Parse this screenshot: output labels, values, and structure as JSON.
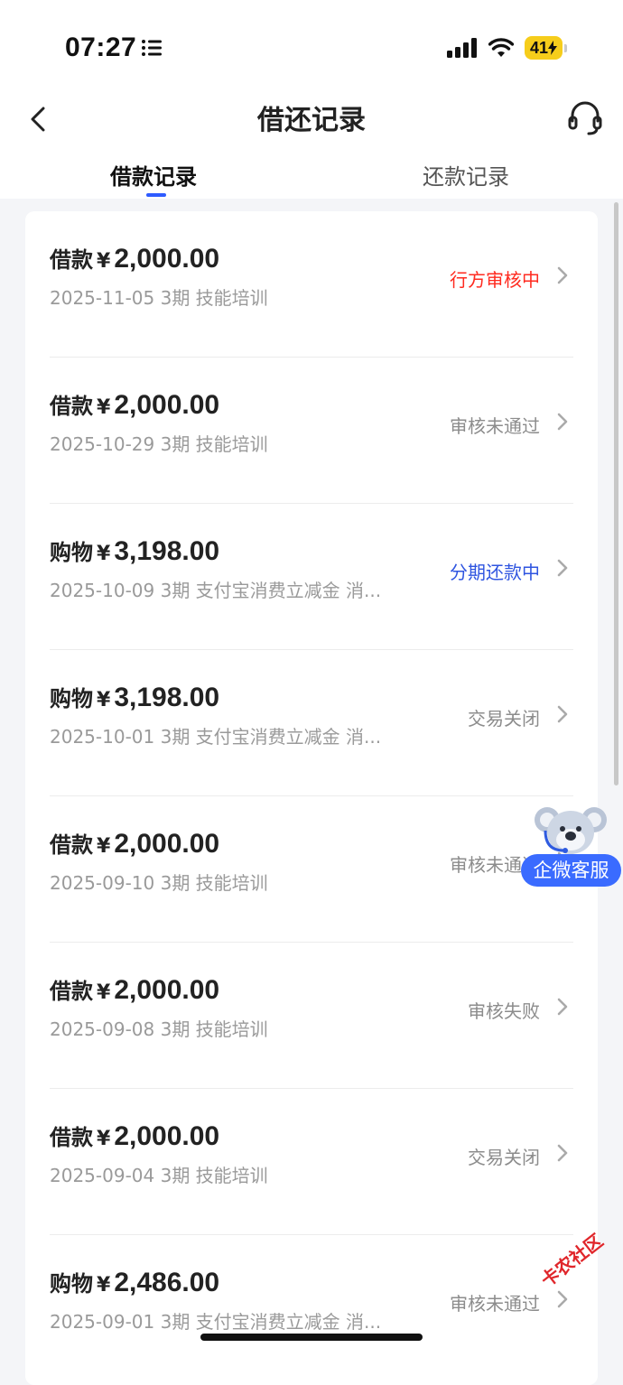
{
  "status_bar": {
    "time": "07:27",
    "battery": "41"
  },
  "header": {
    "title": "借还记录"
  },
  "tabs": [
    {
      "label": "借款记录",
      "active": true
    },
    {
      "label": "还款记录",
      "active": false
    }
  ],
  "records": [
    {
      "type": "借款",
      "currency": "¥",
      "amount": "2,000.00",
      "subtitle": "2025-11-05 3期  技能培训",
      "status": "行方审核中",
      "status_color": "#ff2a1f"
    },
    {
      "type": "借款",
      "currency": "¥",
      "amount": "2,000.00",
      "subtitle": "2025-10-29 3期  技能培训",
      "status": "审核未通过",
      "status_color": "#8c8c8c"
    },
    {
      "type": "购物",
      "currency": "¥",
      "amount": "3,198.00",
      "subtitle": "2025-10-09 3期  支付宝消费立减金 消...",
      "status": "分期还款中",
      "status_color": "#2f55e0"
    },
    {
      "type": "购物",
      "currency": "¥",
      "amount": "3,198.00",
      "subtitle": "2025-10-01 3期  支付宝消费立减金 消...",
      "status": "交易关闭",
      "status_color": "#8c8c8c"
    },
    {
      "type": "借款",
      "currency": "¥",
      "amount": "2,000.00",
      "subtitle": "2025-09-10 3期  技能培训",
      "status": "审核未通过",
      "status_color": "#8c8c8c"
    },
    {
      "type": "借款",
      "currency": "¥",
      "amount": "2,000.00",
      "subtitle": "2025-09-08 3期  技能培训",
      "status": "审核失败",
      "status_color": "#8c8c8c"
    },
    {
      "type": "借款",
      "currency": "¥",
      "amount": "2,000.00",
      "subtitle": "2025-09-04 3期  技能培训",
      "status": "交易关闭",
      "status_color": "#8c8c8c"
    },
    {
      "type": "购物",
      "currency": "¥",
      "amount": "2,486.00",
      "subtitle": "2025-09-01 3期  支付宝消费立减金 消...",
      "status": "审核未通过",
      "status_color": "#8c8c8c"
    }
  ],
  "floating": {
    "customer_service_label": "企微客服"
  },
  "watermark": {
    "text": "卡农社区"
  },
  "colors": {
    "accent": "#2e5bff",
    "status_red": "#ff2a1f",
    "status_blue": "#2f55e0"
  }
}
